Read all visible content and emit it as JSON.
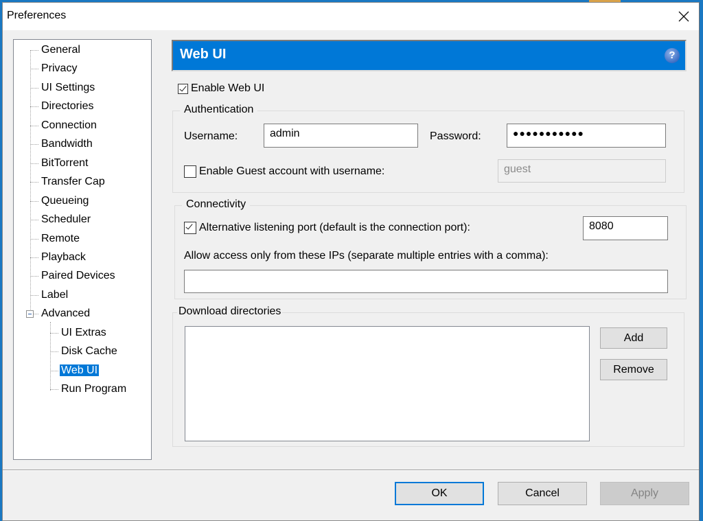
{
  "window": {
    "title": "Preferences"
  },
  "tree": {
    "items": [
      {
        "label": "General",
        "level": 0
      },
      {
        "label": "Privacy",
        "level": 0
      },
      {
        "label": "UI Settings",
        "level": 0
      },
      {
        "label": "Directories",
        "level": 0
      },
      {
        "label": "Connection",
        "level": 0
      },
      {
        "label": "Bandwidth",
        "level": 0
      },
      {
        "label": "BitTorrent",
        "level": 0
      },
      {
        "label": "Transfer Cap",
        "level": 0
      },
      {
        "label": "Queueing",
        "level": 0
      },
      {
        "label": "Scheduler",
        "level": 0
      },
      {
        "label": "Remote",
        "level": 0
      },
      {
        "label": "Playback",
        "level": 0
      },
      {
        "label": "Paired Devices",
        "level": 0
      },
      {
        "label": "Label",
        "level": 0
      },
      {
        "label": "Advanced",
        "level": 0,
        "expanded": true
      },
      {
        "label": "UI Extras",
        "level": 1
      },
      {
        "label": "Disk Cache",
        "level": 1
      },
      {
        "label": "Web UI",
        "level": 1,
        "selected": true
      },
      {
        "label": "Run Program",
        "level": 1
      }
    ]
  },
  "panel": {
    "title": "Web UI",
    "help_icon": "question-mark-icon",
    "enable_webui": {
      "label": "Enable Web UI",
      "checked": true
    },
    "authentication": {
      "title": "Authentication",
      "username_label": "Username:",
      "username_value": "admin",
      "password_label": "Password:",
      "password_value": "●●●●●●●●●●●",
      "guest_label": "Enable Guest account with username:",
      "guest_checked": false,
      "guest_value": "guest"
    },
    "connectivity": {
      "title": "Connectivity",
      "alt_port_label": "Alternative listening port (default is the connection port):",
      "alt_port_checked": true,
      "alt_port_value": "8080",
      "allow_ips_label": "Allow access only from these IPs (separate multiple entries with a comma):",
      "allow_ips_value": ""
    },
    "download_dirs": {
      "title": "Download directories",
      "add_label": "Add",
      "remove_label": "Remove"
    }
  },
  "footer": {
    "ok_label": "OK",
    "cancel_label": "Cancel",
    "apply_label": "Apply"
  }
}
